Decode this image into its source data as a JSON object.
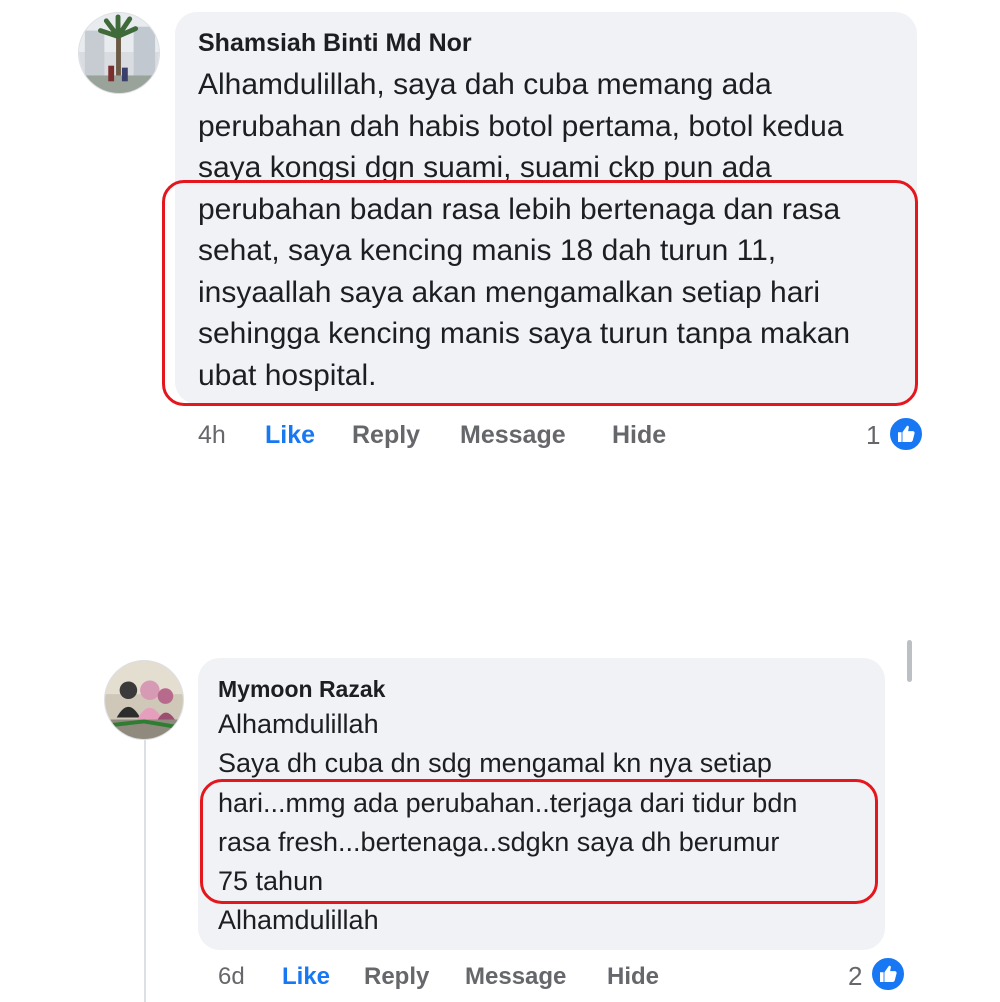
{
  "comments": [
    {
      "author": "Shamsiah Binti Md Nor",
      "lines": [
        "Alhamdulillah, saya dah cuba memang ada",
        "perubahan dah habis botol pertama, botol kedua",
        "saya kongsi dgn suami, suami ckp pun ada",
        "perubahan badan rasa lebih bertenaga dan rasa",
        "sehat, saya kencing manis 18 dah turun 11,",
        "insyaallah saya akan mengamalkan setiap hari",
        "sehingga kencing manis saya turun tanpa makan",
        "ubat hospital."
      ],
      "time": "4h",
      "actions": {
        "like": "Like",
        "reply": "Reply",
        "message": "Message",
        "hide": "Hide"
      },
      "reaction_count": "1",
      "reaction_icon": "thumbs-up-icon"
    },
    {
      "author": "Mymoon Razak",
      "lines": [
        "Alhamdulillah",
        "Saya dh cuba dn sdg mengamal kn nya setiap",
        "hari...mmg ada perubahan..terjaga dari tidur bdn",
        "rasa fresh...bertenaga..sdgkn saya dh berumur",
        "75 tahun",
        "Alhamdulillah"
      ],
      "time": "6d",
      "actions": {
        "like": "Like",
        "reply": "Reply",
        "message": "Message",
        "hide": "Hide"
      },
      "reaction_count": "2",
      "reaction_icon": "thumbs-up-icon"
    }
  ],
  "colors": {
    "bubble": "#f0f2f5",
    "highlight": "#e3171d",
    "like_blue": "#1877f2",
    "muted_text": "#65676b"
  }
}
